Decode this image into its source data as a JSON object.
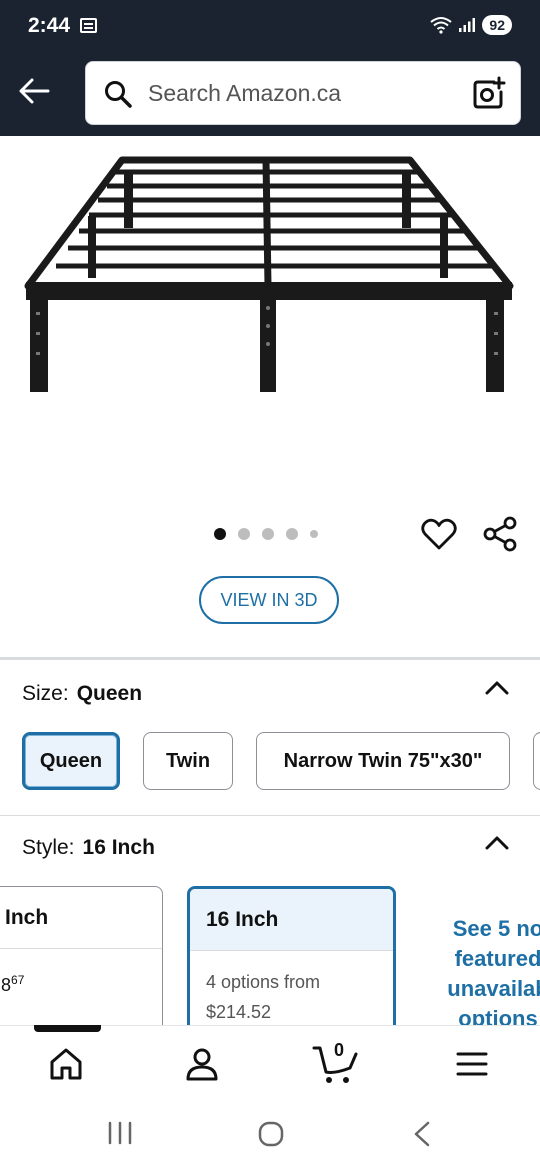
{
  "status_bar": {
    "time": "2:44",
    "battery": "92",
    "icons": [
      "calendar-icon",
      "wifi-icon",
      "signal-icon",
      "battery-icon"
    ]
  },
  "header": {
    "search_placeholder": "Search Amazon.ca",
    "icons": [
      "back-arrow-icon",
      "search-icon",
      "camera-icon"
    ]
  },
  "product": {
    "image_dots": 5,
    "active_dot": 1,
    "view_3d_label": "VIEW IN 3D"
  },
  "size": {
    "label": "Size:",
    "value": "Queen",
    "options": [
      {
        "label": "Queen",
        "selected": true
      },
      {
        "label": "Twin",
        "selected": false
      },
      {
        "label": "Narrow Twin 75\"x30\"",
        "selected": false
      }
    ]
  },
  "style": {
    "label": "Style:",
    "value": "16 Inch",
    "cards": [
      {
        "title": "Inch",
        "line1": "8",
        "line1_sup": "67",
        "selected": false
      },
      {
        "title": "16 Inch",
        "line1": "4 options from",
        "line2": "$214.52",
        "selected": true
      }
    ],
    "see_more": [
      "See 5 no",
      "featured",
      "unavailab",
      "options"
    ]
  },
  "bottom_nav": {
    "cart_count": "0",
    "items": [
      "home-icon",
      "account-icon",
      "cart-icon",
      "menu-icon"
    ]
  },
  "colors": {
    "header_bg": "#1b2331",
    "link_blue": "#1d6fa5",
    "selected_bg": "#eaf3fb"
  }
}
